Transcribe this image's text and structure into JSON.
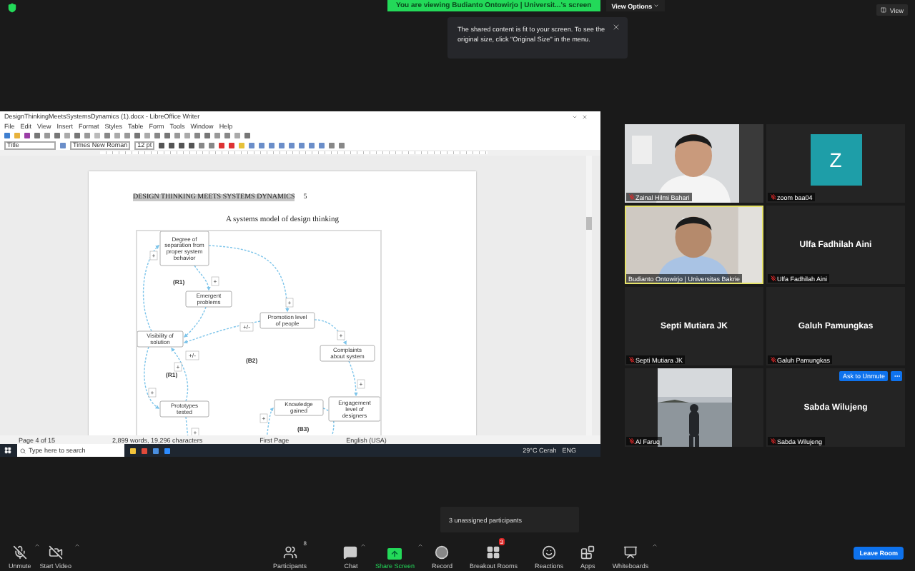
{
  "top_bar": {
    "banner": "You are viewing Budianto Ontowirjo | Universit...'s screen",
    "view_options": "View Options",
    "view": "View"
  },
  "notice": {
    "text": "The shared content is fit to your screen. To see the original size, click \"Original Size\" in the menu."
  },
  "shared_screen": {
    "window_title": "DesignThinkingMeetsSystemsDynamics (1).docx - LibreOffice Writer",
    "menu": [
      "File",
      "Edit",
      "View",
      "Insert",
      "Format",
      "Styles",
      "Table",
      "Form",
      "Tools",
      "Window",
      "Help"
    ],
    "style_box": "Title",
    "font_box": "Times New Roman",
    "size_box": "12 pt",
    "document": {
      "heading": "DESIGN THINKING MEETS SYSTEMS DYNAMICS",
      "page_number": "5",
      "caption": "A systems model of design thinking",
      "diagram": {
        "nodes": [
          {
            "label": "Degree of separation from proper system behavior"
          },
          {
            "label": "Emergent problems"
          },
          {
            "label": "Visibility of solution"
          },
          {
            "label": "Promotion level of people"
          },
          {
            "label": "Complaints about system"
          },
          {
            "label": "Prototypes tested"
          },
          {
            "label": "Knowledge gained"
          },
          {
            "label": "Engagement level of designers"
          }
        ],
        "loops": [
          "(R1)",
          "(R1)",
          "(B2)",
          "(B3)"
        ],
        "polarities": [
          "+",
          "+",
          "+",
          "+/-",
          "+/-",
          "+",
          "+",
          "+",
          "+",
          "+",
          "+"
        ]
      }
    },
    "status_bar": [
      "Page 4 of 15",
      "2,899 words, 19,296 characters",
      "First Page",
      "English (USA)"
    ],
    "taskbar": {
      "search_placeholder": "Type here to search",
      "weather": "29°C Cerah",
      "language": "ENG"
    }
  },
  "participants": [
    {
      "name": "Zainal Hilmi Bahari",
      "kind": "video",
      "active_speaker": false,
      "muted": true
    },
    {
      "name": "zoom baa04",
      "kind": "avatar",
      "avatar_letter": "Z",
      "active_speaker": false,
      "muted": true
    },
    {
      "name": "Budianto Ontowirjo | Universitas Bakrie",
      "kind": "video",
      "active_speaker": true,
      "muted": false
    },
    {
      "name": "Ulfa Fadhilah Aini",
      "kind": "name",
      "display_name": "Ulfa Fadhilah Aini",
      "active_speaker": false,
      "muted": true
    },
    {
      "name": "Septi Mutiara JK",
      "kind": "name",
      "display_name": "Septi Mutiara JK",
      "active_speaker": false,
      "muted": true
    },
    {
      "name": "Galuh Pamungkas",
      "kind": "name",
      "display_name": "Galuh Pamungkas",
      "active_speaker": false,
      "muted": true
    },
    {
      "name": "Al Faruq",
      "kind": "video",
      "active_speaker": false,
      "muted": true
    },
    {
      "name": "Sabda Wilujeng",
      "kind": "name",
      "display_name": "Sabda Wilujeng",
      "active_speaker": false,
      "muted": true,
      "ask_to_unmute": "Ask to Unmute"
    }
  ],
  "unassigned_tooltip": "3 unassigned participants",
  "toolbar": [
    {
      "label": "Unmute",
      "kind": "mic",
      "caret": true
    },
    {
      "label": "Start Video",
      "kind": "video",
      "caret": true
    },
    {
      "label": "Participants",
      "kind": "participants",
      "count": "8",
      "caret": false
    },
    {
      "label": "Chat",
      "kind": "chat",
      "caret": true
    },
    {
      "label": "Share Screen",
      "kind": "share",
      "caret": true
    },
    {
      "label": "Record",
      "kind": "record",
      "caret": false
    },
    {
      "label": "Breakout Rooms",
      "kind": "breakout",
      "badge": "3",
      "caret": false
    },
    {
      "label": "Reactions",
      "kind": "reactions",
      "caret": false
    },
    {
      "label": "Apps",
      "kind": "apps",
      "caret": false
    },
    {
      "label": "Whiteboards",
      "kind": "whiteboards",
      "caret": true
    }
  ],
  "leave_button": "Leave Room"
}
